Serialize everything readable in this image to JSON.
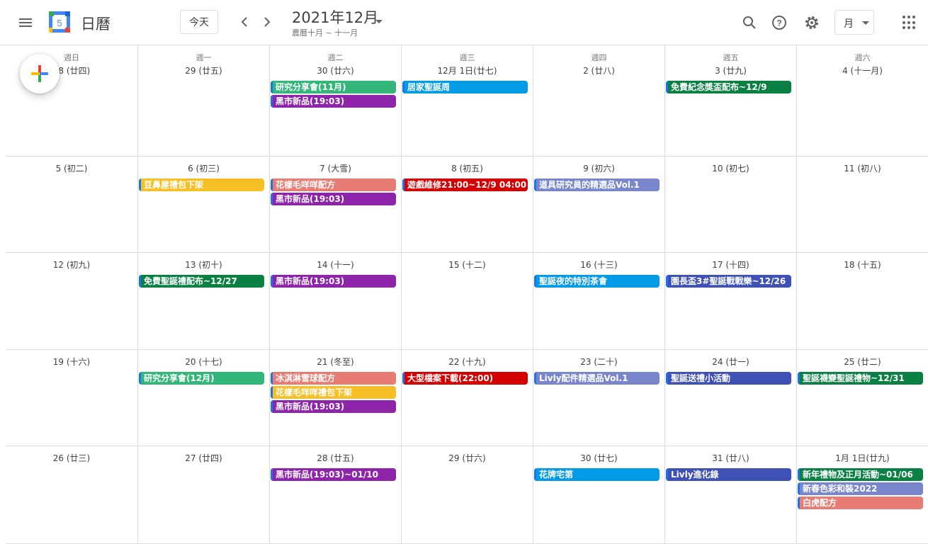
{
  "app": {
    "title": "日曆",
    "logo_number": "5"
  },
  "header": {
    "today_label": "今天",
    "prev_label": "‹",
    "next_label": "›",
    "month_title": "2021年12月",
    "lunar_subtitle": "農曆十月 ~ 十一月",
    "view_label": "月",
    "icons": [
      "menu-icon",
      "search-icon",
      "help-icon",
      "settings-icon",
      "apps-icon"
    ]
  },
  "weekdays": [
    "週日",
    "週一",
    "週二",
    "週三",
    "週四",
    "週五",
    "週六"
  ],
  "weeks": [
    {
      "days": [
        {
          "date": "28 (廿四)",
          "events": []
        },
        {
          "date": "29 (廿五)",
          "events": []
        },
        {
          "date": "30 (廿六)",
          "events": [
            {
              "title": "研究分享會(11月)",
              "color": "#33b679"
            },
            {
              "title": "黑市新品(19:03)",
              "color": "#8e24aa"
            }
          ]
        },
        {
          "date": "12月 1日(廿七)",
          "events": [
            {
              "title": "居家聖誕周",
              "color": "#039be5"
            }
          ]
        },
        {
          "date": "2 (廿八)",
          "events": []
        },
        {
          "date": "3 (廿九)",
          "events": [
            {
              "title": "免費紀念獎盃配布~12/9",
              "color": "#0b8043"
            }
          ]
        },
        {
          "date": "4 (十一月)",
          "events": []
        }
      ]
    },
    {
      "days": [
        {
          "date": "5 (初二)",
          "events": []
        },
        {
          "date": "6 (初三)",
          "events": [
            {
              "title": "豆鼻屋禮包下架",
              "color": "#f6bf26"
            }
          ]
        },
        {
          "date": "7 (大雪)",
          "events": [
            {
              "title": "花樣毛咩咩配方",
              "color": "#e67c73"
            },
            {
              "title": "黑市新品(19:03)",
              "color": "#8e24aa"
            }
          ]
        },
        {
          "date": "8 (初五)",
          "events": [
            {
              "title": "遊戲維修21:00~12/9 04:00",
              "color": "#d50000"
            }
          ]
        },
        {
          "date": "9 (初六)",
          "events": [
            {
              "title": "道具研究員的精選品Vol.1",
              "color": "#7986cb"
            }
          ]
        },
        {
          "date": "10 (初七)",
          "events": []
        },
        {
          "date": "11 (初八)",
          "events": []
        }
      ]
    },
    {
      "days": [
        {
          "date": "12 (初九)",
          "events": []
        },
        {
          "date": "13 (初十)",
          "events": [
            {
              "title": "免費聖誕禮配布~12/27",
              "color": "#0b8043"
            }
          ]
        },
        {
          "date": "14 (十一)",
          "events": [
            {
              "title": "黑市新品(19:03)",
              "color": "#8e24aa"
            }
          ]
        },
        {
          "date": "15 (十二)",
          "events": []
        },
        {
          "date": "16 (十三)",
          "events": [
            {
              "title": "聖誕夜的特別茶會",
              "color": "#039be5"
            }
          ]
        },
        {
          "date": "17 (十四)",
          "events": [
            {
              "title": "園長盃3#聖誕戰戰樂~12/26",
              "color": "#3f51b5"
            }
          ]
        },
        {
          "date": "18 (十五)",
          "events": []
        }
      ]
    },
    {
      "days": [
        {
          "date": "19 (十六)",
          "events": []
        },
        {
          "date": "20 (十七)",
          "events": [
            {
              "title": "研究分享會(12月)",
              "color": "#33b679"
            }
          ]
        },
        {
          "date": "21 (冬至)",
          "events": [
            {
              "title": "冰淇淋雪球配方",
              "color": "#e67c73"
            },
            {
              "title": "花樣毛咩咩禮包下架",
              "color": "#f6bf26"
            },
            {
              "title": "黑市新品(19:03)",
              "color": "#8e24aa"
            }
          ]
        },
        {
          "date": "22 (十九)",
          "events": [
            {
              "title": "大型檔案下載(22:00)",
              "color": "#d50000"
            }
          ]
        },
        {
          "date": "23 (二十)",
          "events": [
            {
              "title": "Livly配件精選品Vol.1",
              "color": "#7986cb"
            }
          ]
        },
        {
          "date": "24 (廿一)",
          "events": [
            {
              "title": "聖誕送禮小活動",
              "color": "#3f51b5"
            }
          ]
        },
        {
          "date": "25 (廿二)",
          "events": [
            {
              "title": "聖誕襪變聖誕禮物~12/31",
              "color": "#0b8043"
            }
          ]
        }
      ]
    },
    {
      "days": [
        {
          "date": "26 (廿三)",
          "events": []
        },
        {
          "date": "27 (廿四)",
          "events": []
        },
        {
          "date": "28 (廿五)",
          "events": [
            {
              "title": "黑市新品(19:03)~01/10",
              "color": "#8e24aa"
            }
          ]
        },
        {
          "date": "29 (廿六)",
          "events": []
        },
        {
          "date": "30 (廿七)",
          "events": [
            {
              "title": "花牌宅第",
              "color": "#039be5"
            }
          ]
        },
        {
          "date": "31 (廿八)",
          "events": [
            {
              "title": "Livly進化錄",
              "color": "#3f51b5"
            }
          ]
        },
        {
          "date": "1月 1日(廿九)",
          "events": [
            {
              "title": "新年禮物及正月活動~01/06",
              "color": "#0b8043"
            },
            {
              "title": "新春色彩和裝2022",
              "color": "#7986cb"
            },
            {
              "title": "白虎配方",
              "color": "#e67c73"
            }
          ]
        }
      ]
    }
  ]
}
